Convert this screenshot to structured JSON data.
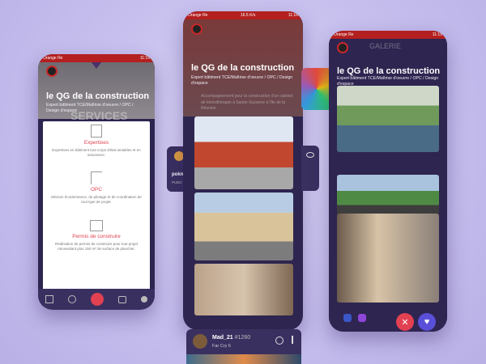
{
  "left_phone": {
    "status": {
      "carrier": "Orange Re",
      "time": "11:15"
    },
    "header": {
      "title": "le QG de la construction",
      "subtitle": "Expert bâtiment TCE/Maîtrise d'oeuvre / OPC / Design d'espace"
    },
    "banner": "SERVICES",
    "services": [
      {
        "title": "Expertises",
        "desc": "Expertises en bâtiment tout corps d'état amiables et en assurance."
      },
      {
        "title": "OPC",
        "desc": "Mission d'ordonnance, de pilotage et de coordination de tout type de projet."
      },
      {
        "title": "Permis de construire",
        "desc": "Réalisation de permis de construire pour tout projet nécessitant plus 150 m² de surface de plancher."
      }
    ],
    "nav_icons": [
      "image-icon",
      "people-icon",
      "gamepad-icon",
      "chat-icon",
      "profile-icon"
    ]
  },
  "center_phone": {
    "status": {
      "carrier": "Orange Re",
      "speed": "16.5 K/s",
      "time": "11:16"
    },
    "header": {
      "title": "le QG de la construction",
      "subtitle": "Expert bâtiment TCE/Maîtrise d'oeuvre / OPC / Design d'espace"
    },
    "overlay_text": "Accompagnement pour la construction d'un cabinet de kinésithérapie à Sainte-Suzanne à l'île de la Réunion"
  },
  "right_phone": {
    "status": {
      "carrier": "Orange Re",
      "time": "11:15"
    },
    "header": {
      "title": "le QG de la construction",
      "subtitle": "Expert bâtiment TCE/Maîtrise d'oeuvre / OPC / Design d'espace"
    },
    "faded_heading": "GALERIE",
    "actions": {
      "reject": "✕",
      "like": "♥"
    }
  },
  "mini_card": {
    "name": "pokm",
    "sub": "PUBG M"
  },
  "bottom_card": {
    "username": "Mad_21",
    "tag": "#1260",
    "game": "Far Cry 6"
  },
  "colors": {
    "accent": "#e24152",
    "brand_red": "#c62828",
    "phone_bg": "#2e2550",
    "like": "#5a4fd8"
  }
}
